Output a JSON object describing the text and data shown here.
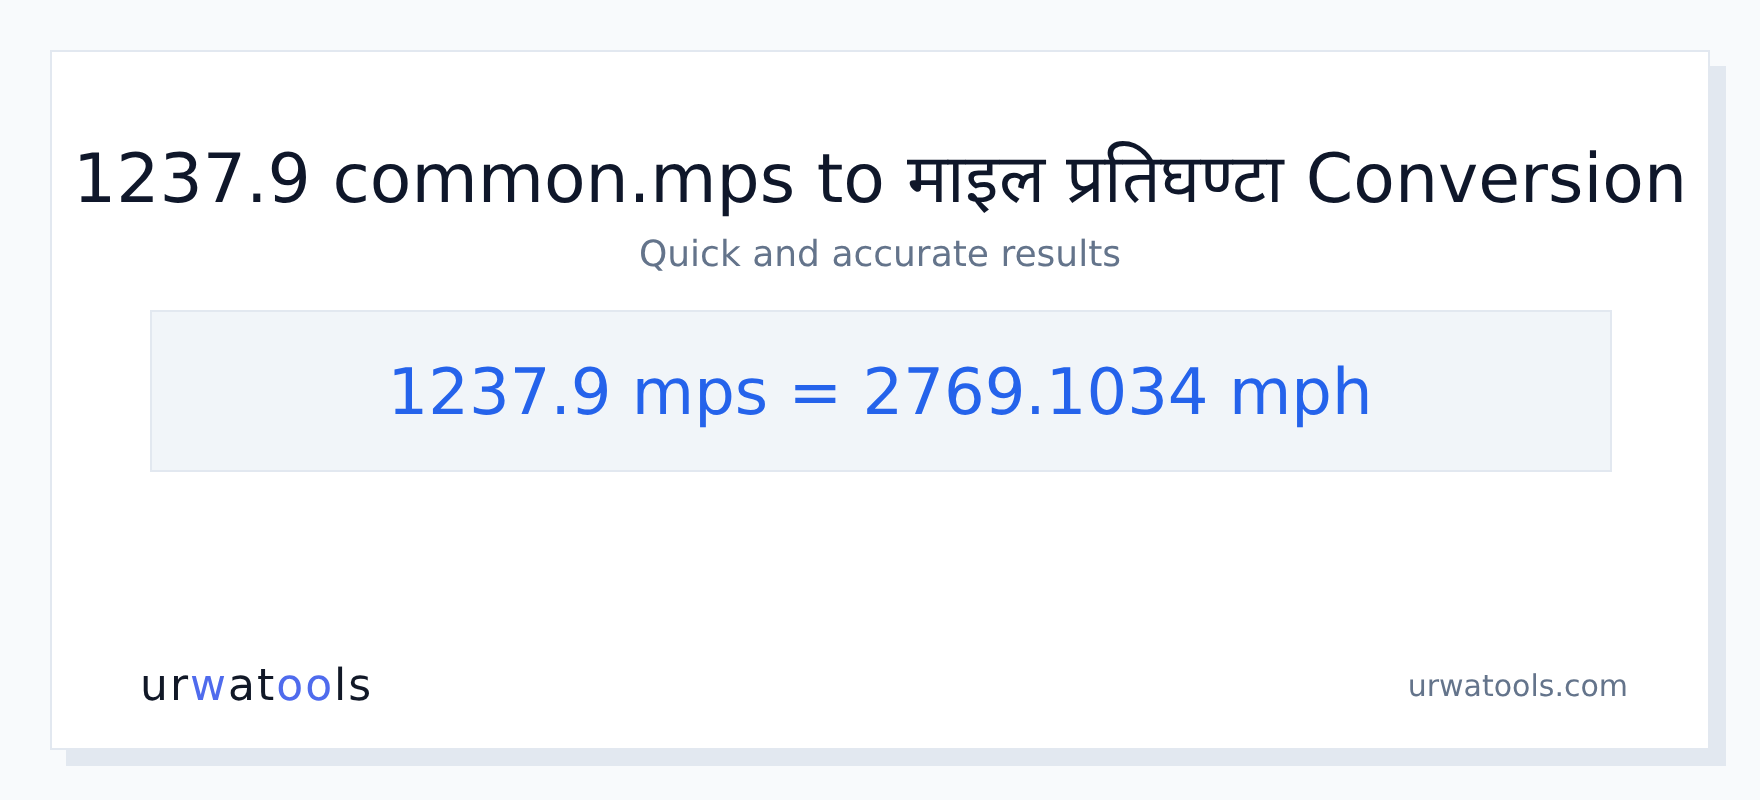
{
  "title": "1237.9 common.mps to माइल प्रतिघण्टा Conversion",
  "subtitle": "Quick and accurate results",
  "result": "1237.9 mps = 2769.1034 mph",
  "logo": {
    "segments": [
      {
        "text": "ur",
        "accent": false
      },
      {
        "text": "w",
        "accent": true
      },
      {
        "text": "at",
        "accent": false
      },
      {
        "text": "oo",
        "accent": true
      },
      {
        "text": "ls",
        "accent": false
      }
    ]
  },
  "site": "urwatools.com"
}
